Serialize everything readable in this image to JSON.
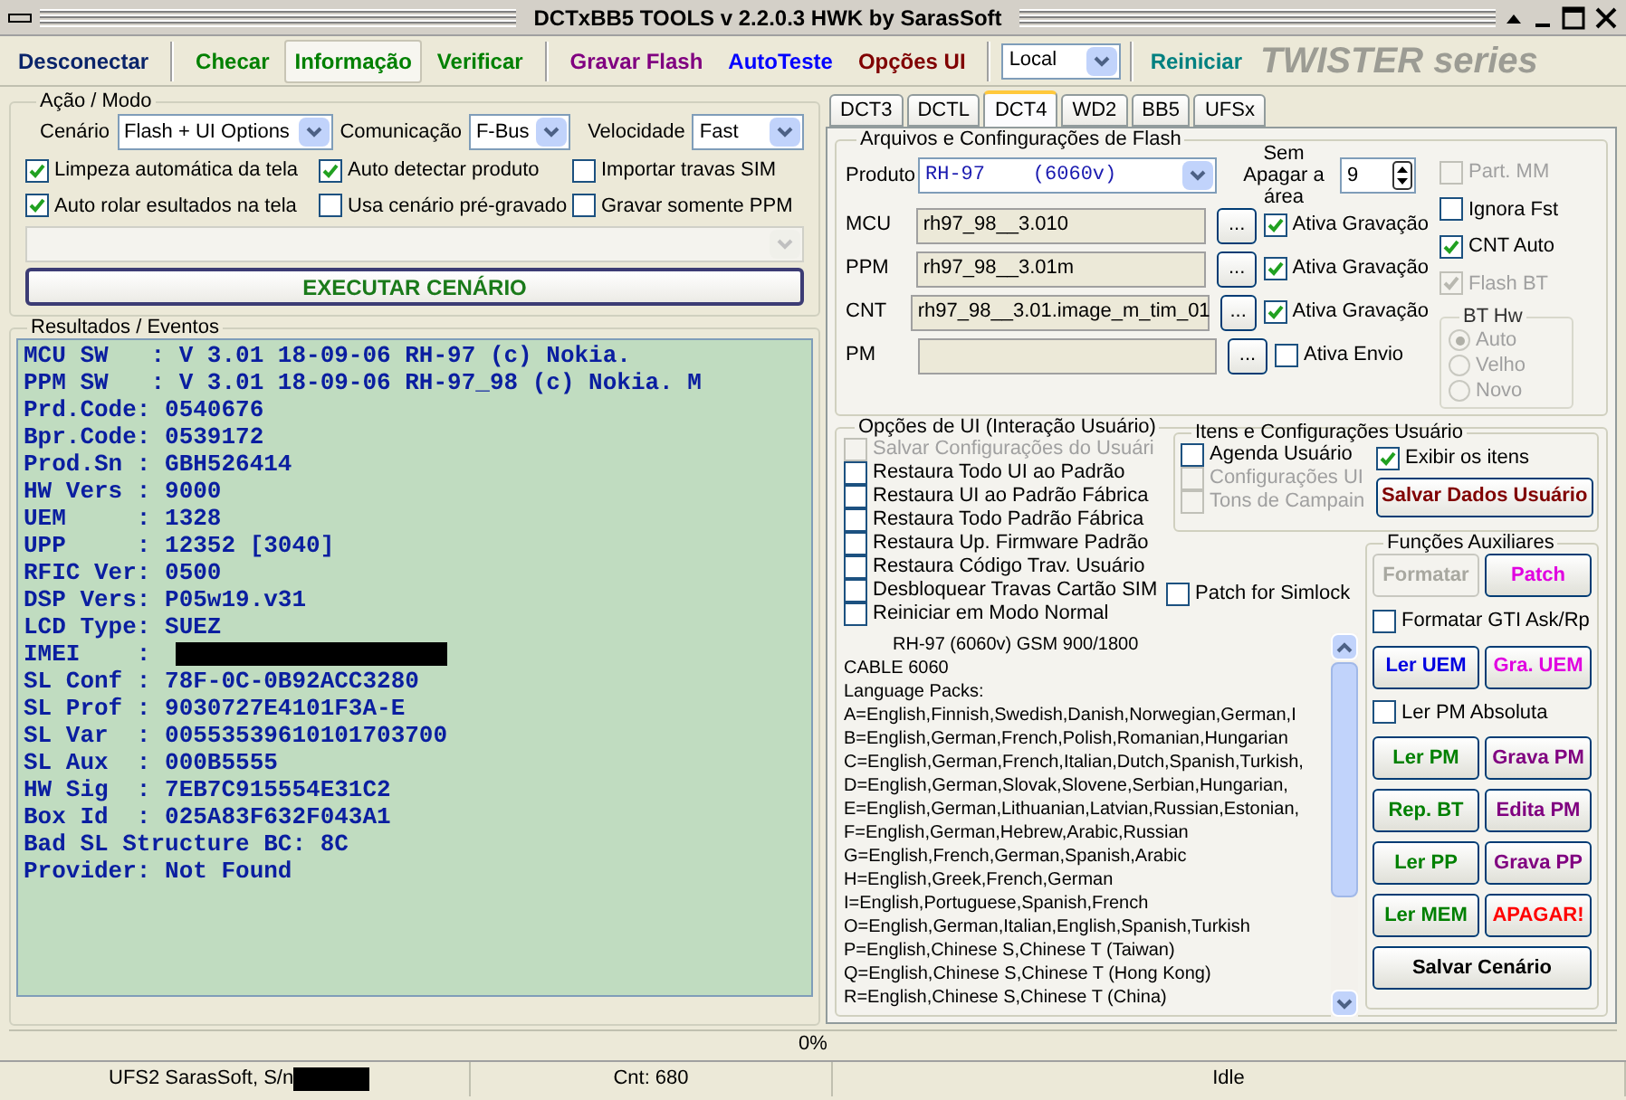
{
  "window": {
    "title": "DCTxBB5 TOOLS v 2.2.0.3 HWK by SarasSoft"
  },
  "toolbar": {
    "buttons": [
      {
        "label": "Desconectar",
        "color": "#0a246a",
        "selected": false
      },
      {
        "label": "Checar",
        "color": "#008000",
        "selected": false
      },
      {
        "label": "Informação",
        "color": "#008000",
        "selected": true
      },
      {
        "label": "Verificar",
        "color": "#008000",
        "selected": false
      },
      {
        "label": "Gravar Flash",
        "color": "#800080",
        "selected": false
      },
      {
        "label": "AutoTeste",
        "color": "#0000ff",
        "selected": false
      },
      {
        "label": "Opções UI",
        "color": "#800000",
        "selected": false
      }
    ],
    "location_select": {
      "value": "Local"
    },
    "restart_button": {
      "label": "Reiniciar",
      "color": "#008080"
    },
    "brand": "TWISTER series"
  },
  "action_mode": {
    "title": "Ação / Modo",
    "selects": [
      {
        "label": "Cenário",
        "value": "Flash + UI Options"
      },
      {
        "label": "Comunicação",
        "value": "F-Bus"
      },
      {
        "label": "Velocidade",
        "value": "Fast"
      }
    ],
    "checkboxes": [
      {
        "label": "Limpeza automática da tela",
        "checked": true
      },
      {
        "label": "Auto detectar produto",
        "checked": true
      },
      {
        "label": "Importar travas SIM",
        "checked": false
      },
      {
        "label": "Auto rolar esultados na tela",
        "checked": true
      },
      {
        "label": "Usa cenário pré-gravado",
        "checked": false
      },
      {
        "label": "Gravar somente PPM",
        "checked": false
      }
    ],
    "execute_button": "EXECUTAR CENÁRIO"
  },
  "results": {
    "title": "Resultados / Eventos",
    "lines": [
      {
        "text": "MCU SW   : V 3.01 18-09-06 RH-97 (c) Nokia."
      },
      {
        "text": "PPM SW   : V 3.01 18-09-06 RH-97_98 (c) Nokia. M"
      },
      {
        "text": "Prd.Code: 0540676"
      },
      {
        "text": "Bpr.Code: 0539172"
      },
      {
        "text": "Prod.Sn : GBH526414"
      },
      {
        "text": "HW Vers : 9000"
      },
      {
        "text": "UEM     : 1328"
      },
      {
        "text": "UPP     : 12352 [3040]"
      },
      {
        "text": "RFIC Ver: 0500"
      },
      {
        "text": "DSP Vers: P05w19.v31"
      },
      {
        "text": "LCD Type: SUEZ"
      },
      {
        "text": "IMEI    :",
        "redacted": true
      },
      {
        "text": "SL Conf : 78F-0C-0B92ACC3280"
      },
      {
        "text": "SL Prof : 9030727E4101F3A-E"
      },
      {
        "text": "SL Var  : 00553539610101703700"
      },
      {
        "text": "SL Aux  : 000B5555"
      },
      {
        "text": "HW Sig  : 7EB7C915554E31C2"
      },
      {
        "text": "Box Id  : 025A83F632F043A1"
      },
      {
        "text": "Bad SL Structure BC: 8C"
      },
      {
        "text": "Provider: Not Found"
      }
    ]
  },
  "tabs": [
    {
      "label": "DCT3",
      "selected": false
    },
    {
      "label": "DCTL",
      "selected": false
    },
    {
      "label": "DCT4",
      "selected": true
    },
    {
      "label": "WD2",
      "selected": false
    },
    {
      "label": "BB5",
      "selected": false
    },
    {
      "label": "UFSx",
      "selected": false
    }
  ],
  "flash_files": {
    "title": "Arquivos e Confingurações de Flash",
    "product": {
      "label": "Produto",
      "value": "RH-97    (6060v)"
    },
    "erase": {
      "label": "Sem Apagar a área",
      "value": "9"
    },
    "files": [
      {
        "label": "MCU",
        "value": "rh97_98__3.010",
        "button": "...",
        "toggle": "Ativa Gravação",
        "checked": true
      },
      {
        "label": "PPM",
        "value": "rh97_98__3.01m",
        "button": "...",
        "toggle": "Ativa Gravação",
        "checked": true
      },
      {
        "label": "CNT",
        "value": "rh97_98__3.01.image_m_tim_01",
        "button": "...",
        "toggle": "Ativa Gravação",
        "checked": true
      },
      {
        "label": "PM",
        "button": "...",
        "toggle": "Ativa Envio",
        "checked": false
      }
    ],
    "options": [
      {
        "label": "Part. MM",
        "checked": false,
        "disabled": true
      },
      {
        "label": "Ignora Fst",
        "checked": false,
        "disabled": false
      },
      {
        "label": "CNT Auto",
        "checked": true,
        "disabled": false
      },
      {
        "label": "Flash BT",
        "checked": true,
        "disabled": true
      }
    ],
    "bt_hw": {
      "title": "BT Hw",
      "radios": [
        {
          "label": "Auto",
          "selected": true
        },
        {
          "label": "Velho",
          "selected": false
        },
        {
          "label": "Novo",
          "selected": false
        }
      ]
    }
  },
  "ui_options": {
    "title": "Opções de UI (Interação Usuário)",
    "checkboxes": [
      {
        "label": "Salvar Configurações do Usuári",
        "checked": false,
        "disabled": true
      },
      {
        "label": "Restaura Todo UI ao Padrão",
        "checked": false,
        "disabled": false
      },
      {
        "label": "Restaura UI ao Padrão Fábrica",
        "checked": false,
        "disabled": false
      },
      {
        "label": "Restaura Todo Padrão Fábrica",
        "checked": false,
        "disabled": false
      },
      {
        "label": "Restaura Up. Firmware Padrão",
        "checked": false,
        "disabled": false
      },
      {
        "label": "Restaura Código Trav. Usuário",
        "checked": false,
        "disabled": false
      },
      {
        "label": "Desbloquear Travas Cartão SIM",
        "checked": false,
        "disabled": false
      },
      {
        "label": "Reiniciar em Modo Normal",
        "checked": false,
        "disabled": false
      }
    ],
    "patch_simlock": {
      "label": "Patch for Simlock",
      "checked": false
    }
  },
  "user_items": {
    "title": "Itens e Configurações Usuário",
    "checkboxes": [
      {
        "label": "Agenda Usuário",
        "checked": false,
        "disabled": false
      },
      {
        "label": "Configurações UI",
        "checked": false,
        "disabled": true
      },
      {
        "label": "Tons de Campain",
        "checked": false,
        "disabled": true
      }
    ],
    "show_items": {
      "label": "Exibir os itens",
      "checked": true
    },
    "save_button": "Salvar Dados Usuário"
  },
  "info_text": {
    "lines": [
      "RH-97 (6060v) GSM 900/1800",
      "CABLE 6060",
      "Language Packs:",
      "A=English,Finnish,Swedish,Danish,Norwegian,German,I",
      "B=English,German,French,Polish,Romanian,Hungarian",
      "C=English,German,French,Italian,Dutch,Spanish,Turkish,",
      "D=English,German,Slovak,Slovene,Serbian,Hungarian,",
      "E=English,German,Lithuanian,Latvian,Russian,Estonian,",
      "F=English,German,Hebrew,Arabic,Russian",
      "G=English,French,German,Spanish,Arabic",
      "H=English,Greek,French,German",
      "I=English,Portuguese,Spanish,French",
      "O=English,German,Italian,English,Spanish,Turkish",
      "P=English,Chinese S,Chinese T (Taiwan)",
      "Q=English,Chinese S,Chinese T (Hong Kong)",
      "R=English,Chinese S,Chinese T (China)"
    ]
  },
  "aux": {
    "title": "Funções Auxiliares",
    "items": [
      {
        "kind": "button",
        "label": "Formatar",
        "disabled": true
      },
      {
        "kind": "button",
        "label": "Patch",
        "color": "#e000e0",
        "disabled": false
      },
      {
        "kind": "checkbox",
        "label": "Formatar GTI Ask/Rp",
        "checked": false
      },
      {
        "kind": "button",
        "label": "Ler UEM",
        "color": "#0000e0",
        "disabled": false
      },
      {
        "kind": "button",
        "label": "Gra. UEM",
        "color": "#e000e0",
        "disabled": false
      },
      {
        "kind": "checkbox",
        "label": "Ler PM Absoluta",
        "checked": false
      },
      {
        "kind": "button",
        "label": "Ler PM",
        "color": "#008000",
        "disabled": false
      },
      {
        "kind": "button",
        "label": "Grava PM",
        "color": "#800080",
        "disabled": false
      },
      {
        "kind": "button",
        "label": "Rep. BT",
        "color": "#008000",
        "disabled": false
      },
      {
        "kind": "button",
        "label": "Edita PM",
        "color": "#800080",
        "disabled": false
      },
      {
        "kind": "button",
        "label": "Ler PP",
        "color": "#008000",
        "disabled": false
      },
      {
        "kind": "button",
        "label": "Grava PP",
        "color": "#800080",
        "disabled": false
      },
      {
        "kind": "button",
        "label": "Ler MEM",
        "color": "#008000",
        "disabled": false
      },
      {
        "kind": "button",
        "label": "APAGAR!",
        "color": "#ff0000",
        "disabled": false
      },
      {
        "kind": "wide_button",
        "label": "Salvar Cenário",
        "color": "#000000",
        "disabled": false
      }
    ]
  },
  "progress": {
    "text": "0%",
    "level": 0
  },
  "status_bar": [
    {
      "text": "UFS2 SarasSoft, S/n",
      "redacted": true
    },
    {
      "text": "Cnt: 680"
    },
    {
      "text": "Idle"
    }
  ]
}
